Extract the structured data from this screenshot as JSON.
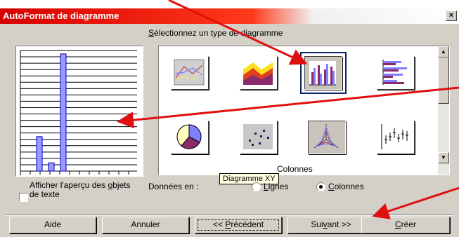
{
  "window": {
    "title": "AutoFormat de diagramme",
    "close_label": "×"
  },
  "gallery": {
    "heading_pre": "S",
    "heading_rest": "électionnez un type de diagramme",
    "tiles": [
      {
        "name": "line-chart-icon"
      },
      {
        "name": "area-chart-icon"
      },
      {
        "name": "column-chart-icon",
        "selected": true
      },
      {
        "name": "bar-chart-icon"
      },
      {
        "name": "pie-chart-icon"
      },
      {
        "name": "xy-scatter-chart-icon"
      },
      {
        "name": "radar-chart-icon"
      },
      {
        "name": "stock-chart-icon"
      }
    ],
    "tooltip": "Diagramme XY",
    "under_label": "Colonnes"
  },
  "data_series": {
    "label": "Données en :",
    "option_rows_pre": "",
    "option_rows_ul": "L",
    "option_rows_rest": "ignes",
    "option_cols_pre": "",
    "option_cols_ul": "C",
    "option_cols_rest": "olonnes",
    "selected": "Colonnes"
  },
  "preview": {
    "values": [
      50,
      12,
      170
    ],
    "checkbox_line1_pre": "Afficher l'aperçu des ",
    "checkbox_line1_ul": "o",
    "checkbox_line1_rest": "bjets",
    "checkbox_line2": "de texte"
  },
  "buttons": {
    "help": "Aide",
    "cancel": "Annuler",
    "prev_pre": "<< ",
    "prev_ul": "P",
    "prev_rest": "récédent",
    "next_pre": "Sui",
    "next_ul": "v",
    "next_rest": "ant >>",
    "finish_pre": "",
    "finish_ul": "C",
    "finish_rest": "réer"
  },
  "colors": {
    "arrow": "#e01010",
    "accent": "#0a246a",
    "series": "#9999ff"
  }
}
